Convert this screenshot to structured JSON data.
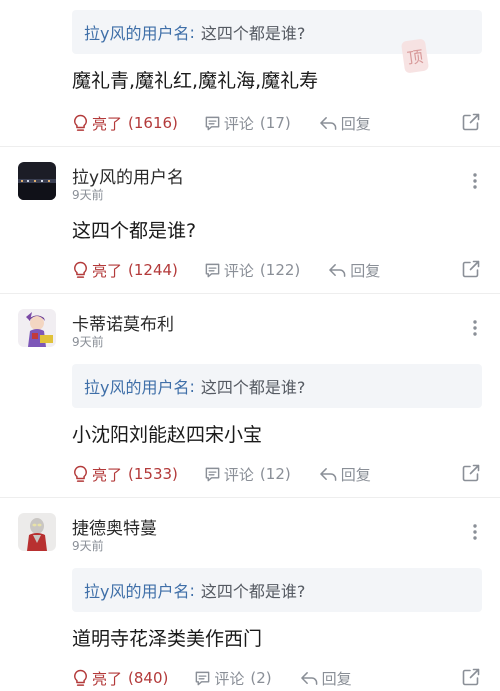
{
  "colors": {
    "like": "#b33a3a",
    "meta": "#8a8f97",
    "quote_name": "#3f6fa8",
    "quote_bg": "#f3f5f8"
  },
  "stamp_text": "顶",
  "comments": [
    {
      "quote": {
        "name": "拉y风的用户名",
        "colon": ":",
        "text": "这四个都是谁?"
      },
      "content": "魔礼青,魔礼红,魔礼海,魔礼寿",
      "like_label": "亮了",
      "like_count": "(1616)",
      "comment_label": "评论",
      "comment_count": "(17)",
      "reply_label": "回复"
    },
    {
      "user": "拉y风的用户名",
      "time": "9天前",
      "avatar_icon": "night-city-avatar",
      "content": "这四个都是谁?",
      "like_label": "亮了",
      "like_count": "(1244)",
      "comment_label": "评论",
      "comment_count": "(122)",
      "reply_label": "回复"
    },
    {
      "user": "卡蒂诺莫布利",
      "time": "9天前",
      "avatar_icon": "anime-character-avatar",
      "quote": {
        "name": "拉y风的用户名",
        "colon": ":",
        "text": "这四个都是谁?"
      },
      "content": "小沈阳刘能赵四宋小宝",
      "like_label": "亮了",
      "like_count": "(1533)",
      "comment_label": "评论",
      "comment_count": "(12)",
      "reply_label": "回复"
    },
    {
      "user": "捷德奥特蔓",
      "time": "9天前",
      "avatar_icon": "ultraman-avatar",
      "quote": {
        "name": "拉y风的用户名",
        "colon": ":",
        "text": "这四个都是谁?"
      },
      "content": "道明寺花泽类美作西门",
      "like_label": "亮了",
      "like_count": "(840)",
      "comment_label": "评论",
      "comment_count": "(2)",
      "reply_label": "回复"
    }
  ]
}
